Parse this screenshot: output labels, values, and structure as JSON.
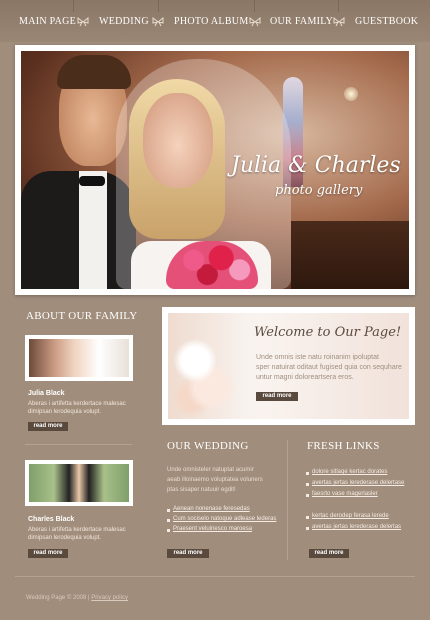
{
  "nav": {
    "items": [
      "MAIN PAGE",
      "WEDDING",
      "PHOTO ALBUM",
      "OUR FAMILY",
      "GUESTBOOK"
    ],
    "separator_icon": "bow-icon"
  },
  "hero": {
    "title": "Julia & Charles",
    "subtitle": "photo gallery"
  },
  "family": {
    "heading": "ABOUT OUR FAMILY",
    "members": [
      {
        "name": "Julia Black",
        "lines": [
          "Aberas i artifetta kerdertace malesac",
          "dimipsan lerodequia volupt."
        ],
        "button": "read more"
      },
      {
        "name": "Charles Black",
        "lines": [
          "Aberas i artifetta kerdertace malesac",
          "dimipsan lerodequia volupt."
        ],
        "button": "read more"
      }
    ]
  },
  "welcome": {
    "title": "Welcome to Our Page!",
    "lines": [
      "Unde omnis iste natu roinanim ipoluptat",
      "sper natuirat oditaut fugised quia con sequhare",
      "untur magni doloreartsera eros."
    ],
    "button": "read more"
  },
  "wedding": {
    "heading": "OUR WEDDING",
    "lines": [
      "Unde omnisteler natuptat acumir",
      "aeab illoinaemo voluptatea voluners",
      "ptas sisaper natuuir egdit!"
    ],
    "links": [
      "Aenean nonenase feresedas",
      "Cum sociselo natoque adlease lederas",
      "Praesent veluinesco maroesa"
    ],
    "button": "read more"
  },
  "fresh": {
    "heading": "FRESH LINKS",
    "links_group1": [
      "dolore sitlaqe kertac dorates",
      "avertas jertas lerederase delertase",
      "faesrto vase magerlasler"
    ],
    "links_group2": [
      "kertac derodep ferasa lerede",
      "avertas jertas lerederase delertas"
    ],
    "button": "read more"
  },
  "footer": {
    "copyright": "Wedding Page © 2008",
    "separator": "|",
    "privacy": "Privacy policy"
  },
  "colors": {
    "background": "#a08d7c",
    "nav": "#8a7766",
    "button": "#5a4a3e",
    "text": "#f4ece4"
  }
}
